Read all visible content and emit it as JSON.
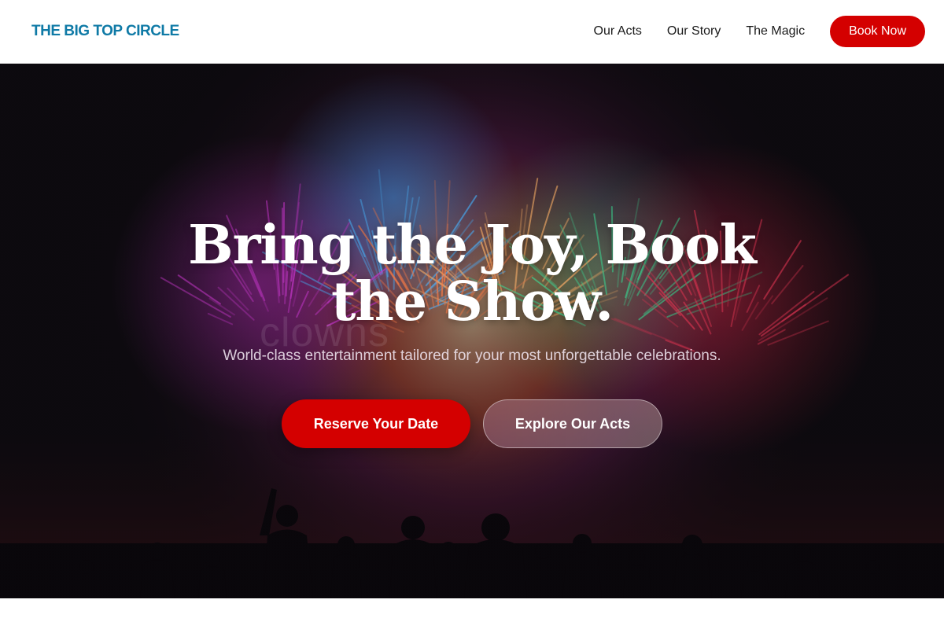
{
  "header": {
    "logo": "THE BIG TOP CIRCLE",
    "nav": [
      {
        "label": "Our Acts"
      },
      {
        "label": "Our Story"
      },
      {
        "label": "The Magic"
      }
    ],
    "cta_label": "Book Now"
  },
  "hero": {
    "title": "Bring the Joy, Book the Show.",
    "ghost_text": "clowns",
    "subtitle": "World-class entertainment tailored for your most unforgettable celebrations.",
    "primary_button": "Reserve Your Date",
    "secondary_button": "Explore Our Acts",
    "background": "fireworks-crowd-silhouette-image"
  },
  "colors": {
    "brand": "#0f7aa6",
    "accent": "#d40000",
    "hero_bg": "#0e0b10"
  }
}
